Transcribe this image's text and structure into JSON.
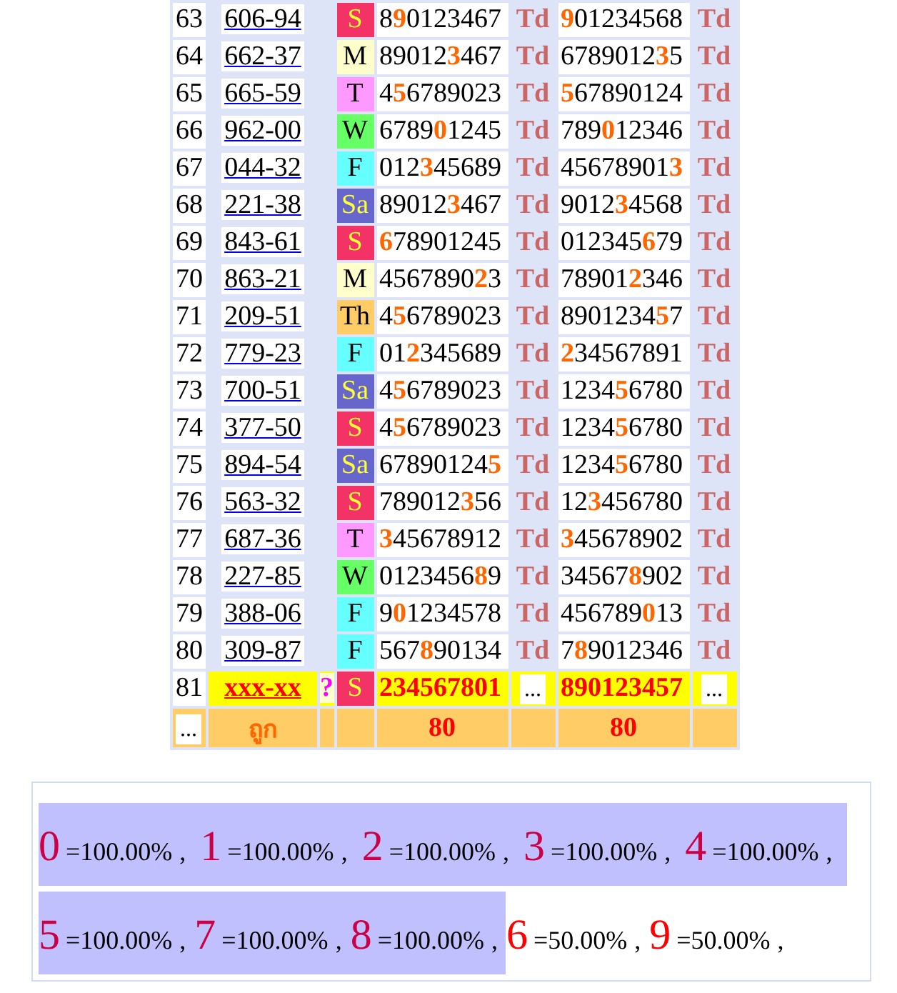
{
  "table": {
    "rows": [
      {
        "kind": "result",
        "no": "63",
        "code": "606-94",
        "day": {
          "label": "S",
          "color": "#f33366"
        },
        "first": "8**9**0123467",
        "first_tag": "Td",
        "second": "**9**01234568",
        "second_tag": "Td"
      },
      {
        "kind": "result",
        "no": "64",
        "code": "662-37",
        "day": {
          "label": "M",
          "color": "#ffffcc"
        },
        "first": "89012**3**467",
        "first_tag": "Td",
        "second": "6789012**3**5",
        "second_tag": "Td"
      },
      {
        "kind": "result",
        "no": "65",
        "code": "665-59",
        "day": {
          "label": "T",
          "color": "#ff99ff"
        },
        "first": "4**5**6789023",
        "first_tag": "Td",
        "second": "**5**67890124",
        "second_tag": "Td"
      },
      {
        "kind": "result",
        "no": "66",
        "code": "962-00",
        "day": {
          "label": "W",
          "color": "#66ff66"
        },
        "first": "6789**0**1245",
        "first_tag": "Td",
        "second": "789**0**12346",
        "second_tag": "Td"
      },
      {
        "kind": "result",
        "no": "67",
        "code": "044-32",
        "day": {
          "label": "F",
          "color": "#66ffff"
        },
        "first": "012**3**45689",
        "first_tag": "Td",
        "second": "45678901**3**",
        "second_tag": "Td"
      },
      {
        "kind": "result",
        "no": "68",
        "code": "221-38",
        "day": {
          "label": "Sa",
          "color": "#6666cc"
        },
        "first": "89012**3**467",
        "first_tag": "Td",
        "second": "9012**3**4568",
        "second_tag": "Td"
      },
      {
        "kind": "result",
        "no": "69",
        "code": "843-61",
        "day": {
          "label": "S",
          "color": "#f33366"
        },
        "first": "**6**78901245",
        "first_tag": "Td",
        "second": "012345**6**79",
        "second_tag": "Td"
      },
      {
        "kind": "result",
        "no": "70",
        "code": "863-21",
        "day": {
          "label": "M",
          "color": "#ffffcc"
        },
        "first": "4567890**2**3",
        "first_tag": "Td",
        "second": "78901**2**346",
        "second_tag": "Td"
      },
      {
        "kind": "result",
        "no": "71",
        "code": "209-51",
        "day": {
          "label": "Th",
          "color": "#ffcc66"
        },
        "first": "4**5**6789023",
        "first_tag": "Td",
        "second": "8901234**5**7",
        "second_tag": "Td"
      },
      {
        "kind": "result",
        "no": "72",
        "code": "779-23",
        "day": {
          "label": "F",
          "color": "#66ffff"
        },
        "first": "01**2**345689",
        "first_tag": "Td",
        "second": "**2**34567891",
        "second_tag": "Td"
      },
      {
        "kind": "result",
        "no": "73",
        "code": "700-51",
        "day": {
          "label": "Sa",
          "color": "#6666cc"
        },
        "first": "4**5**6789023",
        "first_tag": "Td",
        "second": "1234**5**6780",
        "second_tag": "Td"
      },
      {
        "kind": "result",
        "no": "74",
        "code": "377-50",
        "day": {
          "label": "S",
          "color": "#f33366"
        },
        "first": "4**5**6789023",
        "first_tag": "Td",
        "second": "1234**5**6780",
        "second_tag": "Td"
      },
      {
        "kind": "result",
        "no": "75",
        "code": "894-54",
        "day": {
          "label": "Sa",
          "color": "#6666cc"
        },
        "first": "67890124**5**",
        "first_tag": "Td",
        "second": "1234**5**6780",
        "second_tag": "Td"
      },
      {
        "kind": "result",
        "no": "76",
        "code": "563-32",
        "day": {
          "label": "S",
          "color": "#f33366"
        },
        "first": "789012**3**56",
        "first_tag": "Td",
        "second": "12**3**456780",
        "second_tag": "Td"
      },
      {
        "kind": "result",
        "no": "77",
        "code": "687-36",
        "day": {
          "label": "T",
          "color": "#ff99ff"
        },
        "first": "**3**45678912",
        "first_tag": "Td",
        "second": "**3**45678902",
        "second_tag": "Td"
      },
      {
        "kind": "result",
        "no": "78",
        "code": "227-85",
        "day": {
          "label": "W",
          "color": "#66ff66"
        },
        "first": "0123456**8**9",
        "first_tag": "Td",
        "second": "34567**8**902",
        "second_tag": "Td"
      },
      {
        "kind": "result",
        "no": "79",
        "code": "388-06",
        "day": {
          "label": "F",
          "color": "#66ffff"
        },
        "first": "9**0**1234578",
        "first_tag": "Td",
        "second": "456789**0**13",
        "second_tag": "Td"
      },
      {
        "kind": "result",
        "no": "80",
        "code": "309-87",
        "day": {
          "label": "F",
          "color": "#66ffff"
        },
        "first": "567**8**90134",
        "first_tag": "Td",
        "second": "7**8**9012346",
        "second_tag": "Td"
      },
      {
        "kind": "pending",
        "no": "81",
        "code": "xxx-xx",
        "query": "?",
        "day": {
          "label": "S",
          "color": "#f33366"
        },
        "first": "234567801",
        "first_tag": "...",
        "second": "890123457",
        "second_tag": "..."
      }
    ],
    "footer": {
      "no": "...",
      "label": "ถูก",
      "first": "80",
      "second": "80"
    }
  },
  "stats": [
    {
      "digit": "0",
      "percent": "=100.00%",
      "sep": ",",
      "highlighted": true,
      "color": "#cc0044"
    },
    {
      "digit": "1",
      "percent": "=100.00%",
      "sep": ",",
      "highlighted": true,
      "color": "#cc0044"
    },
    {
      "digit": "2",
      "percent": "=100.00%",
      "sep": ",",
      "highlighted": true,
      "color": "#cc0044"
    },
    {
      "digit": "3",
      "percent": "=100.00%",
      "sep": ",",
      "highlighted": true,
      "color": "#cc0044"
    },
    {
      "digit": "4",
      "percent": "=100.00%",
      "sep": ",",
      "highlighted": true,
      "color": "#cc0044"
    },
    {
      "digit": "5",
      "percent": "=100.00%",
      "sep": ",",
      "highlighted": true,
      "color": "#cc0044"
    },
    {
      "digit": "7",
      "percent": "=100.00%",
      "sep": ",",
      "highlighted": true,
      "color": "#cc0044"
    },
    {
      "digit": "8",
      "percent": "=100.00%",
      "sep": ",",
      "highlighted": true,
      "color": "#cc0044"
    },
    {
      "digit": "6",
      "percent": "=50.00%",
      "sep": ",",
      "highlighted": false,
      "color": "#ff0000"
    },
    {
      "digit": "9",
      "percent": "=50.00%",
      "sep": ",",
      "highlighted": false,
      "color": "#ff0000"
    }
  ]
}
